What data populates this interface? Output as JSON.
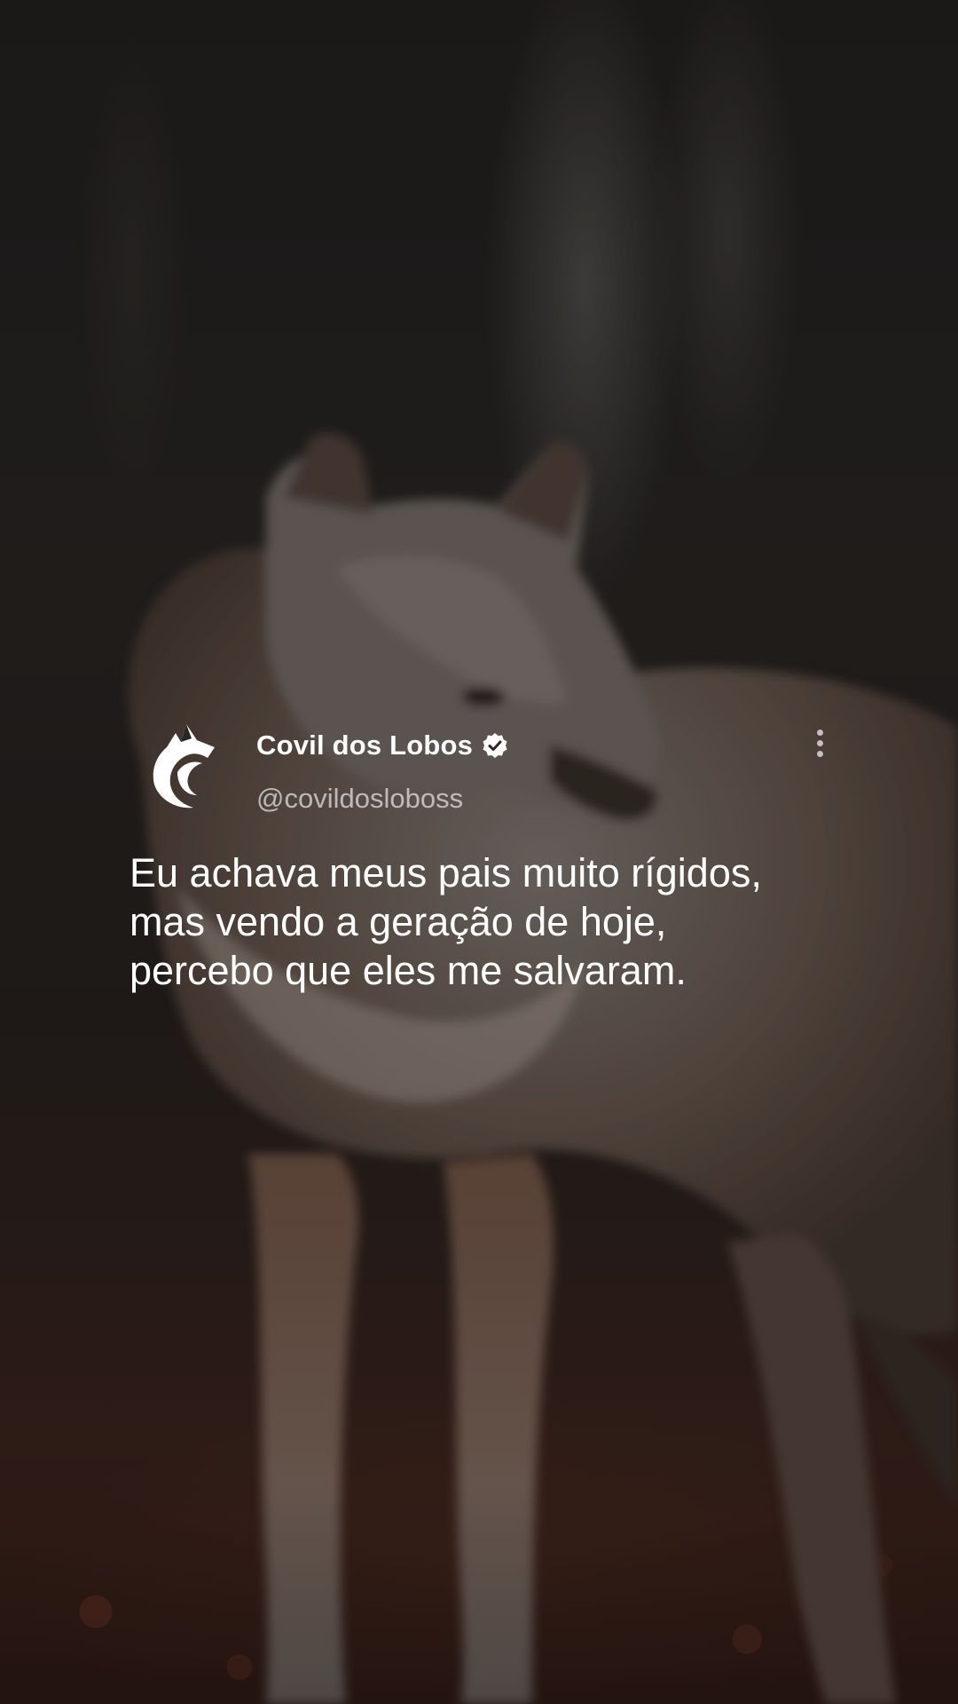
{
  "post": {
    "display_name": "Covil dos Lobos",
    "handle": "@covildosloboss",
    "verified": true,
    "text_lines": [
      "Eu achava meus pais muito rígidos,",
      "mas vendo a geração de hoje,",
      "percebo que eles me salvaram."
    ],
    "icons": {
      "avatar": "wolf-logo-icon",
      "verified": "verified-badge-icon",
      "menu": "more-options-icon"
    }
  },
  "colors": {
    "text": "#ffffff",
    "handle": "#b8b8b8",
    "background": "#2a2522"
  }
}
